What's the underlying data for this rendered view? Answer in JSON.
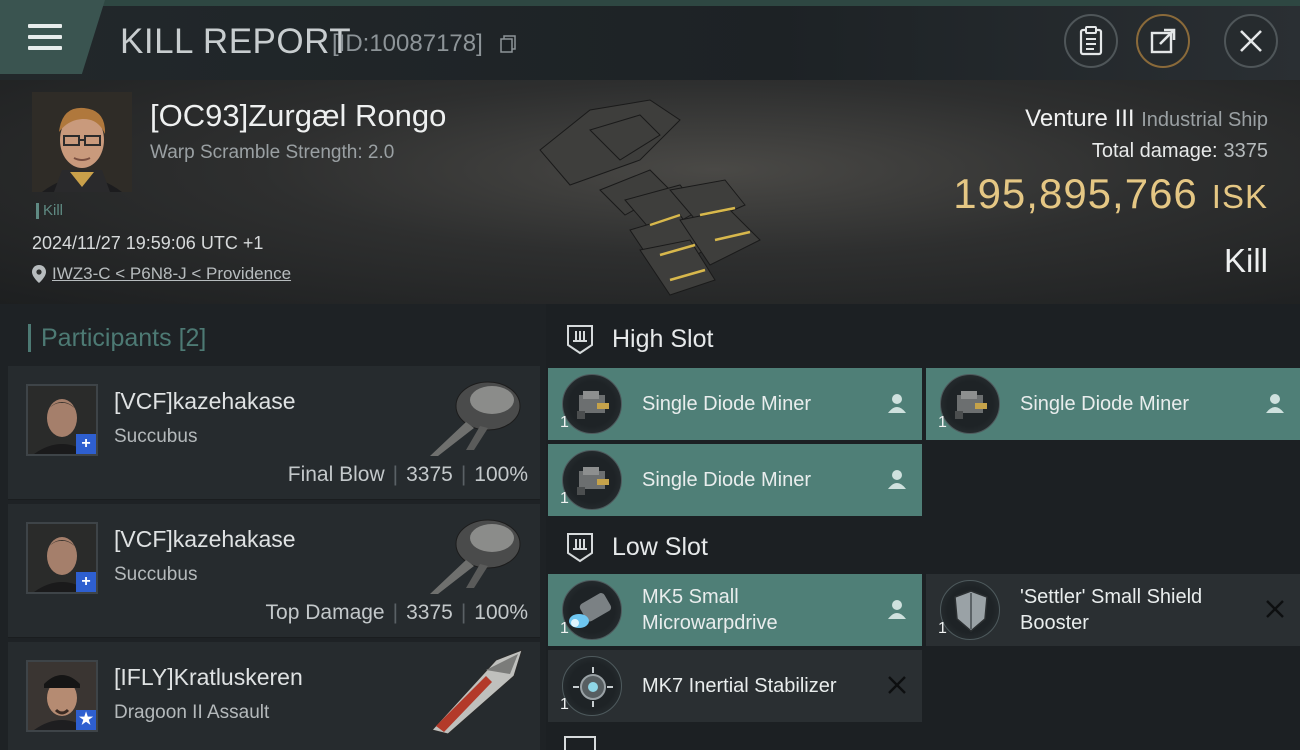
{
  "header": {
    "title": "KILL REPORT",
    "report_id": "[ID:10087178]"
  },
  "victim": {
    "pilot_name": "[OC93]Zurgæl Rongo",
    "warp_scramble": "Warp Scramble Strength: 2.0",
    "tag": "Kill",
    "time": "2024/11/27 19:59:06 UTC +1",
    "location": "IWZ3-C < P6N8-J < Providence",
    "ship_name": "Venture III",
    "ship_class": "Industrial Ship",
    "total_damage_label": "Total damage:",
    "total_damage": "3375",
    "isk_value": "195,895,766",
    "isk_unit": "ISK",
    "result": "Kill"
  },
  "participants": {
    "title": "Participants",
    "count": "[2]",
    "rows": [
      {
        "name": "[VCF]kazehakase",
        "ship": "Succubus",
        "role": "Final Blow",
        "damage": "3375",
        "percent": "100%",
        "badge": "+"
      },
      {
        "name": "[VCF]kazehakase",
        "ship": "Succubus",
        "role": "Top Damage",
        "damage": "3375",
        "percent": "100%",
        "badge": "+"
      },
      {
        "name": "[IFLY]Kratluskeren",
        "ship": "Dragoon II Assault",
        "badge": "★"
      }
    ]
  },
  "slots": {
    "high": {
      "label": "High Slot",
      "modules": [
        {
          "name": "Single Diode Miner",
          "qty": "1",
          "status": "pilot-icon"
        },
        {
          "name": "Single Diode Miner",
          "qty": "1",
          "status": "pilot-icon"
        },
        {
          "name": "Single Diode Miner",
          "qty": "1",
          "status": "pilot-icon"
        }
      ]
    },
    "low": {
      "label": "Low Slot",
      "modules": [
        {
          "name": "MK5 Small Microwarpdrive",
          "qty": "1",
          "status": "pilot-icon"
        },
        {
          "name": "'Settler' Small Shield Booster",
          "qty": "1",
          "status": "destroyed-icon"
        },
        {
          "name": "MK7 Inertial Stabilizer",
          "qty": "1",
          "status": "destroyed-icon"
        }
      ]
    }
  },
  "colors": {
    "accent_teal": "#4f7f77",
    "isk_gold": "#e5c784",
    "corp_badge_blue": "#2e5fd0"
  }
}
